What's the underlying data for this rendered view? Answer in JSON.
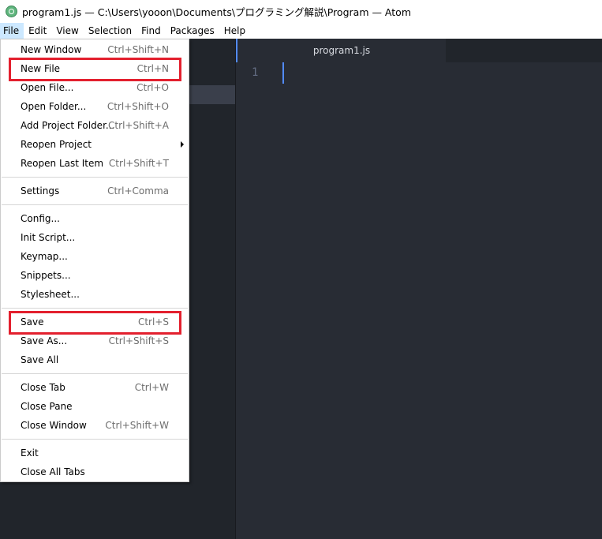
{
  "window": {
    "title": "program1.js — C:\\Users\\yooon\\Documents\\プログラミング解説\\Program — Atom"
  },
  "menubar": [
    "File",
    "Edit",
    "View",
    "Selection",
    "Find",
    "Packages",
    "Help"
  ],
  "tab": {
    "label": "program1.js"
  },
  "editor": {
    "line_number": "1"
  },
  "file_menu": {
    "groups": [
      [
        {
          "label": "New Window",
          "shortcut": "Ctrl+Shift+N"
        },
        {
          "label": "New File",
          "shortcut": "Ctrl+N",
          "highlighted": true
        },
        {
          "label": "Open File...",
          "shortcut": "Ctrl+O"
        },
        {
          "label": "Open Folder...",
          "shortcut": "Ctrl+Shift+O"
        },
        {
          "label": "Add Project Folder...",
          "shortcut": "Ctrl+Shift+A"
        },
        {
          "label": "Reopen Project",
          "shortcut": "",
          "submenu": true
        },
        {
          "label": "Reopen Last Item",
          "shortcut": "Ctrl+Shift+T"
        }
      ],
      [
        {
          "label": "Settings",
          "shortcut": "Ctrl+Comma"
        }
      ],
      [
        {
          "label": "Config...",
          "shortcut": ""
        },
        {
          "label": "Init Script...",
          "shortcut": ""
        },
        {
          "label": "Keymap...",
          "shortcut": ""
        },
        {
          "label": "Snippets...",
          "shortcut": ""
        },
        {
          "label": "Stylesheet...",
          "shortcut": ""
        }
      ],
      [
        {
          "label": "Save",
          "shortcut": "Ctrl+S",
          "highlighted": true
        },
        {
          "label": "Save As...",
          "shortcut": "Ctrl+Shift+S"
        },
        {
          "label": "Save All",
          "shortcut": ""
        }
      ],
      [
        {
          "label": "Close Tab",
          "shortcut": "Ctrl+W"
        },
        {
          "label": "Close Pane",
          "shortcut": ""
        },
        {
          "label": "Close Window",
          "shortcut": "Ctrl+Shift+W"
        }
      ],
      [
        {
          "label": "Exit",
          "shortcut": ""
        },
        {
          "label": "Close All Tabs",
          "shortcut": ""
        }
      ]
    ]
  },
  "colors": {
    "highlight_box": "#e3202e",
    "editor_bg": "#282c34",
    "cursor": "#528bff"
  }
}
